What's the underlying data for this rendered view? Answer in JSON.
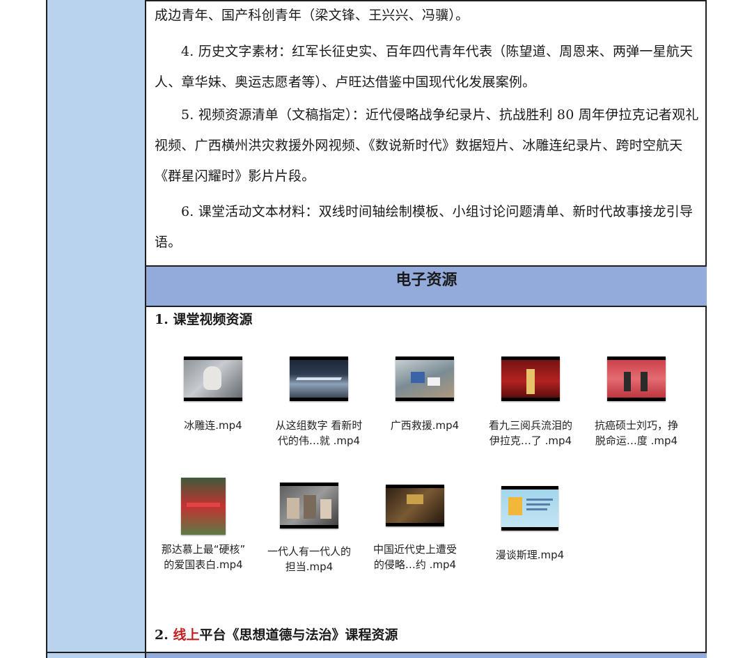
{
  "paragraphs": [
    "成边青年、国产科创青年（梁文锋、王兴兴、冯骥）。",
    "4. 历史文字素材：红军长征史实、百年四代青年代表（陈望道、周恩来、两弹一星航天人、章华妹、奥运志愿者等）、卢旺达借鉴中国现代化发展案例。",
    "5. 视频资源清单（文稿指定）：近代侵略战争纪录片、抗战胜利 80 周年伊拉克记者观礼视频、广西横州洪灾救援外网视频、《数说新时代》数据短片、冰雕连纪录片、跨时空航天《群星闪耀时》影片片段。",
    "6. 课堂活动文本材料：双线时间轴绘制模板、小组讨论问题清单、新时代故事接龙引导语。"
  ],
  "section_header": "电子资源",
  "subsection1": "1. 课堂视频资源",
  "subsection2": {
    "prefix": "2. ",
    "accent": "线上",
    "rest": "平台《思想道德与法治》课程资源"
  },
  "accent_color": "#c21f1f",
  "files": [
    {
      "line1": "冰雕连.mp4",
      "line2": "",
      "thumb": "snow-soldier-frame"
    },
    {
      "line1": "从这组数字 看新时",
      "line2": "代的伟…就 .mp4",
      "thumb": "highway-frame"
    },
    {
      "line1": "广西救援.mp4",
      "line2": "",
      "thumb": "flood-rescue-frame"
    },
    {
      "line1": "看九三阅兵流泪的",
      "line2": "伊拉克…了 .mp4",
      "thumb": "parade-stage-frame"
    },
    {
      "line1": "抗癌硕士刘巧，挣",
      "line2": "脱命运…度 .mp4",
      "thumb": "red-stage-frame"
    },
    {
      "line1": "那达慕上最“硬核”",
      "line2": "的爱国表白.mp4",
      "thumb": "grassland-flags-frame"
    },
    {
      "line1": "一代人有一代人的",
      "line2": "担当.mp4",
      "thumb": "generations-collage-frame"
    },
    {
      "line1": "中国近代史上遭受",
      "line2": "的侵略…约 .mp4",
      "thumb": "history-doc-frame"
    },
    {
      "line1": "漫谈斯理.mp4",
      "line2": "",
      "thumb": "book-slide-frame"
    }
  ]
}
